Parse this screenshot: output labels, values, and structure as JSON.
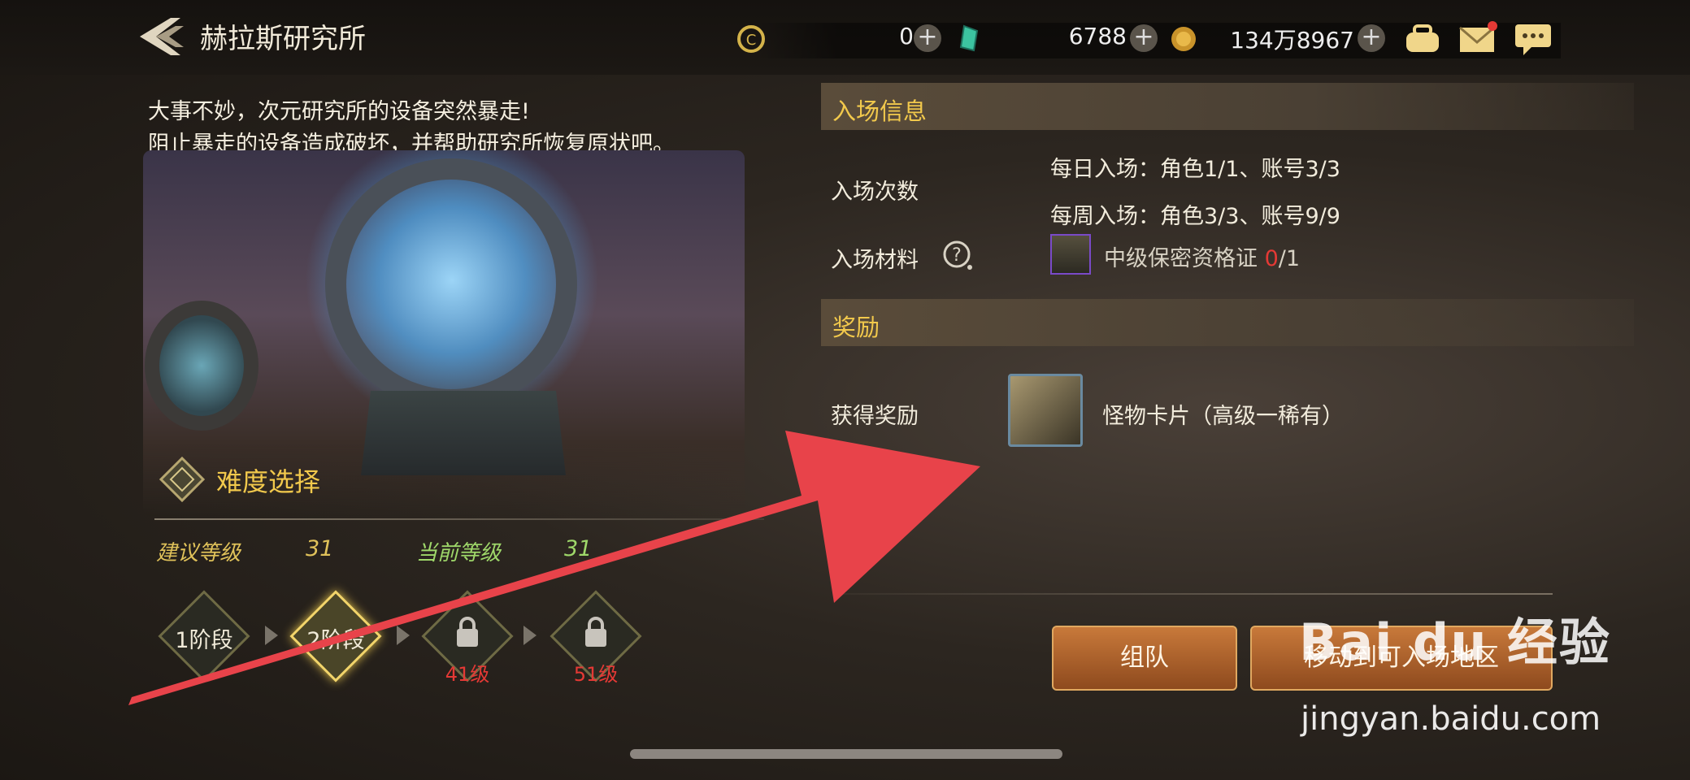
{
  "header": {
    "title": "赫拉斯研究所",
    "resources": [
      {
        "icon": "circle-c-currency-icon",
        "value": "0"
      },
      {
        "icon": "green-crystal-icon",
        "value": "6788"
      },
      {
        "icon": "gold-coin-icon",
        "value": "134万8967"
      }
    ],
    "icons": [
      "bag-icon",
      "mail-icon",
      "chat-icon"
    ],
    "mail_badge_color": "#e53935"
  },
  "intro": {
    "line1": "大事不妙，次元研究所的设备突然暴走!",
    "line2": "阻止暴走的设备造成破坏，并帮助研究所恢复原状吧。"
  },
  "difficulty": {
    "title": "难度选择",
    "recommended_label": "建议等级",
    "recommended_value": "31",
    "current_label": "当前等级",
    "current_value": "31",
    "stages": [
      {
        "label": "1阶段",
        "sub": "",
        "locked": false
      },
      {
        "label": "2阶段",
        "sub": "",
        "locked": false,
        "selected": true
      },
      {
        "label": "",
        "sub": "41级",
        "locked": true
      },
      {
        "label": "",
        "sub": "51级",
        "locked": true
      }
    ]
  },
  "entry": {
    "section_title": "入场信息",
    "count_label": "入场次数",
    "daily": "每日入场：角色1/1、账号3/3",
    "weekly": "每周入场：角色3/3、账号9/9",
    "material_label": "入场材料",
    "material_name": "中级保密资格证",
    "material_have": "0",
    "material_need": "/1"
  },
  "reward": {
    "section_title": "奖励",
    "label": "获得奖励",
    "item": "怪物卡片（高级一稀有）"
  },
  "buttons": {
    "team": "组队",
    "move": "移动到可入场地区"
  },
  "watermark": {
    "logo": "Bai du 经验",
    "url": "jingyan.baidu.com"
  },
  "colors": {
    "accent_gold": "#f2c94c",
    "recommended_color": "#e0c25a",
    "current_color": "#9fd86a",
    "warning_red": "#e53935",
    "button_orange": "#b8652c",
    "arrow_red": "#e8434a"
  }
}
